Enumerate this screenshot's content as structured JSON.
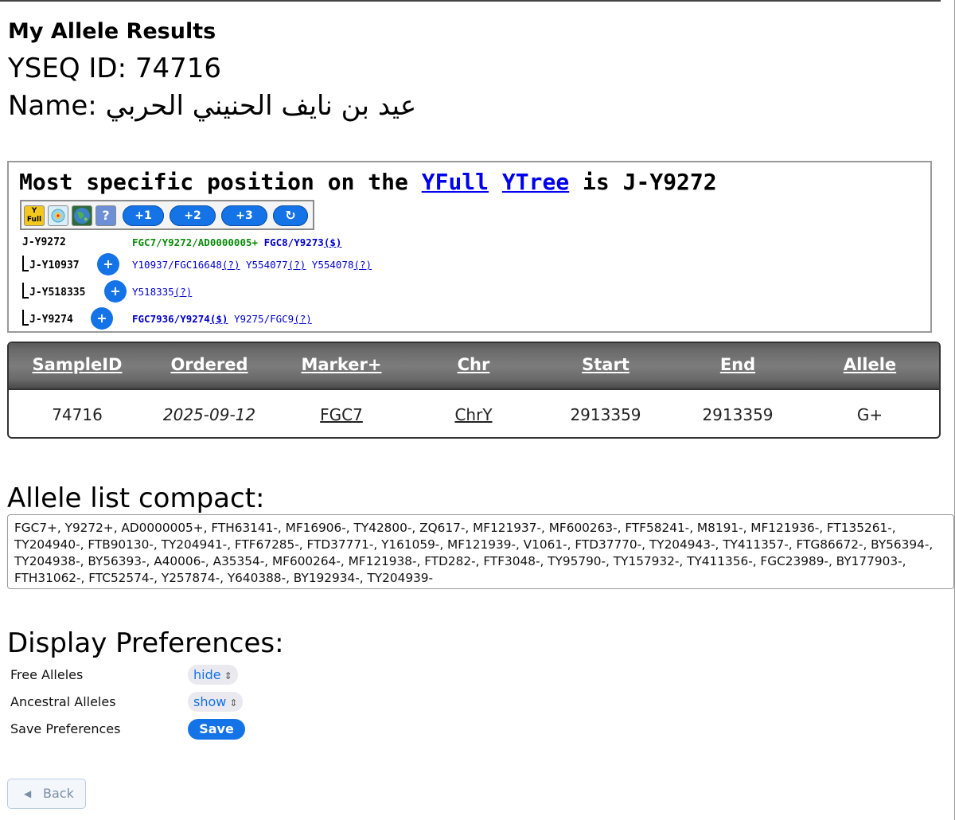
{
  "header": {
    "title": "My Allele Results",
    "yseq_id": "YSEQ ID: 74716",
    "name_label": "Name:",
    "name_value": "عيد بن نايف الحنيني الحربي"
  },
  "tree": {
    "heading_prefix": "Most specific position on the",
    "link_yfull": "YFull",
    "link_ytree": "YTree",
    "heading_suffix": "is J-Y9272",
    "toolbar": {
      "yfull_icon_text": "Y Full",
      "help_icon": "?",
      "plus1": "+1",
      "plus2": "+2",
      "plus3": "+3",
      "reset_icon": "↻"
    },
    "root": {
      "label": "J-Y9272",
      "snp_green": "FGC7/Y9272/AD0000005+",
      "snp_blue": "FGC8/Y9273",
      "snp_blue_link": "($)"
    },
    "children": [
      {
        "label": "J-Y10937",
        "expand": "+",
        "snps": [
          {
            "name": "Y10937/FGC16648",
            "link": "(?)"
          },
          {
            "name": "Y554077",
            "link": "(?)"
          },
          {
            "name": "Y554078",
            "link": "(?)"
          }
        ]
      },
      {
        "label": "J-Y518335",
        "expand": "+",
        "snps": [
          {
            "name": "Y518335",
            "link": "(?)"
          }
        ]
      },
      {
        "label": "J-Y9274",
        "expand": "+",
        "snps": [
          {
            "name": "FGC7936/Y9274",
            "link": "($)"
          },
          {
            "name": "Y9275/FGC9",
            "link": "(?)"
          }
        ]
      }
    ]
  },
  "table": {
    "headers": [
      "SampleID",
      "Ordered",
      "Marker+",
      "Chr",
      "Start",
      "End",
      "Allele"
    ],
    "row": [
      "74716",
      "2025-09-12",
      "FGC7",
      "ChrY",
      "2913359",
      "2913359",
      "G+"
    ]
  },
  "allele_list": {
    "title": "Allele list compact:",
    "text": "FGC7+, Y9272+, AD0000005+, FTH63141-, MF16906-, TY42800-, ZQ617-, MF121937-, MF600263-, FTF58241-, M8191-, MF121936-, FT135261-, TY204940-, FTB90130-, TY204941-, FTF67285-, FTD37771-, Y161059-, MF121939-, V1061-, FTD37770-, TY204943-, TY411357-, FTG86672-, BY56394-, TY204938-, BY56393-, A40006-, A35354-, MF600264-, MF121938-, FTD282-, FTF3048-, TY95790-, TY157932-, TY411356-, FGC23989-, BY177903-, FTH31062-, FTC52574-, Y257874-, Y640388-, BY192934-, TY204939-"
  },
  "preferences": {
    "title": "Display Preferences:",
    "free_alleles_label": "Free Alleles",
    "free_alleles_value": "hide",
    "ancestral_alleles_label": "Ancestral Alleles",
    "ancestral_alleles_value": "show",
    "save_label": "Save Preferences",
    "save_button": "Save"
  },
  "back_button": "Back"
}
